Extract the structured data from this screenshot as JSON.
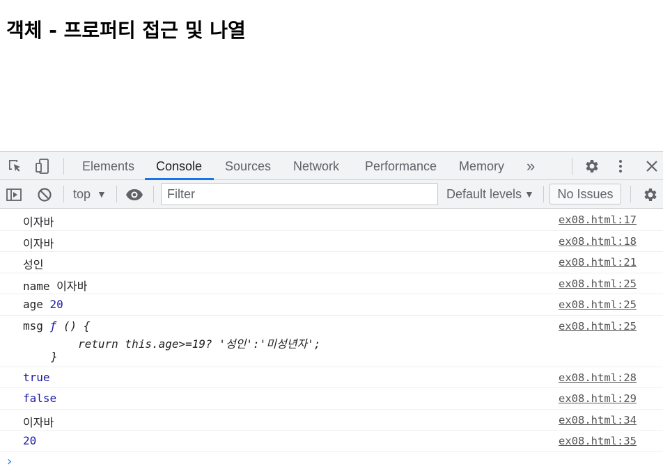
{
  "page": {
    "heading": "객체 - 프로퍼티 접근 및 나열"
  },
  "devtools": {
    "tabs": [
      {
        "label": "Elements"
      },
      {
        "label": "Console"
      },
      {
        "label": "Sources"
      },
      {
        "label": "Network"
      },
      {
        "label": "Performance"
      },
      {
        "label": "Memory"
      }
    ],
    "more_tabs": "»",
    "toolbar": {
      "context": "top",
      "filter_placeholder": "Filter",
      "levels": "Default levels",
      "issues": "No Issues"
    },
    "messages": [
      {
        "text": "이자바",
        "source": "ex08.html:17"
      },
      {
        "text": "이자바",
        "source": "ex08.html:18"
      },
      {
        "text": "성인",
        "source": "ex08.html:21"
      },
      {
        "key": "name",
        "value": "이자바",
        "source": "ex08.html:25"
      },
      {
        "key": "age",
        "value": "20",
        "source": "ex08.html:25"
      },
      {
        "key": "msg",
        "fn_symbol": "ƒ",
        "fn_sig": "() {",
        "fn_body": "return this.age>=19? '성인':'미성년자';",
        "fn_end": "}",
        "source": "ex08.html:25"
      },
      {
        "text": "true",
        "source": "ex08.html:28"
      },
      {
        "text": "false",
        "source": "ex08.html:29"
      },
      {
        "text": "이자바",
        "source": "ex08.html:34"
      },
      {
        "text": "20",
        "source": "ex08.html:35"
      }
    ],
    "prompt": "›"
  }
}
